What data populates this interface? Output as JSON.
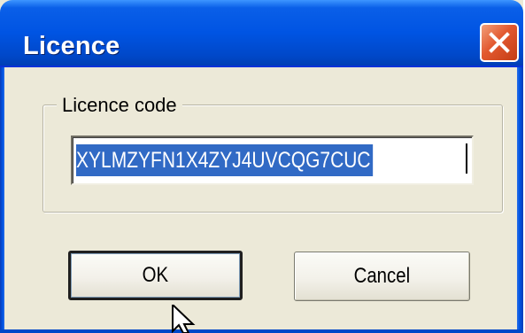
{
  "window": {
    "title": "Licence"
  },
  "licence_group": {
    "label": "Licence code",
    "code_value": "XYLMZYFN1X4ZYJ4UVCQG7CUC"
  },
  "buttons": {
    "ok_label": "OK",
    "cancel_label": "Cancel"
  },
  "icons": {
    "close": "close-icon",
    "cursor": "mouse-pointer-icon"
  },
  "colors": {
    "titlebar": "#0054e3",
    "close_button": "#e2582f",
    "selection": "#316ac5",
    "dialog_background": "#ece9d8"
  }
}
